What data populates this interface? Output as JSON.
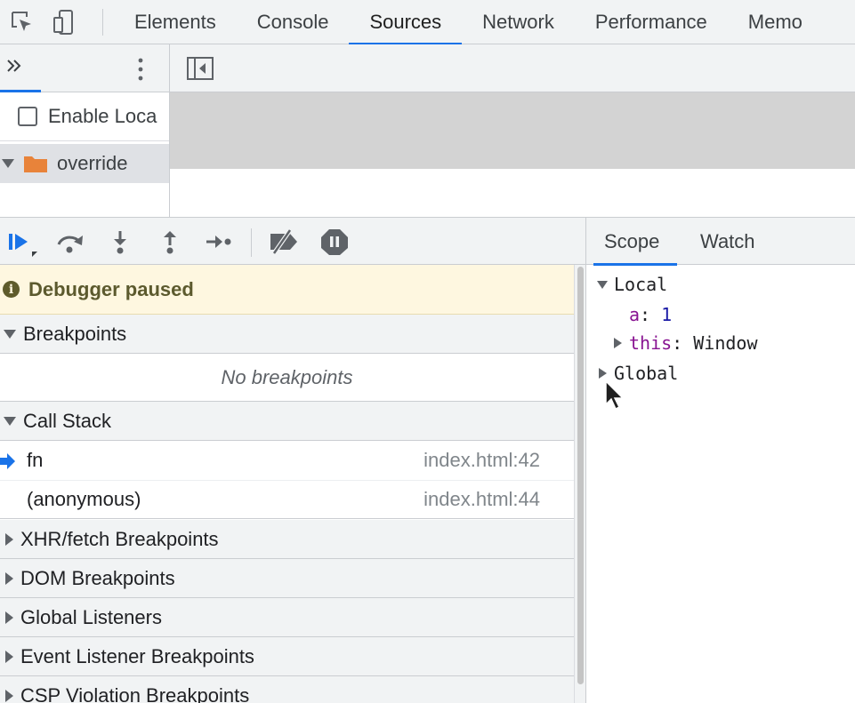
{
  "top_tabs": [
    "Elements",
    "Console",
    "Sources",
    "Network",
    "Performance",
    "Memo"
  ],
  "active_tab": "Sources",
  "navigator": {
    "enable_label": "Enable Loca",
    "folder_label": "override"
  },
  "debug_toolbar": {
    "icons": [
      "resume-icon",
      "step-over-icon",
      "step-into-icon",
      "step-out-icon",
      "step-icon",
      "deactivate-breakpoints-icon",
      "pause-on-exceptions-icon"
    ]
  },
  "sidebar": {
    "paused_label": "Debugger paused",
    "breakpoints_label": "Breakpoints",
    "no_breakpoints": "No breakpoints",
    "call_stack_label": "Call Stack",
    "frames": [
      {
        "name": "fn",
        "location": "index.html:42"
      },
      {
        "name": "(anonymous)",
        "location": "index.html:44"
      }
    ],
    "xhr_label": "XHR/fetch Breakpoints",
    "dom_label": "DOM Breakpoints",
    "global_label": "Global Listeners",
    "event_label": "Event Listener Breakpoints",
    "csp_label": "CSP Violation Breakpoints"
  },
  "scope": {
    "tab_scope": "Scope",
    "tab_watch": "Watch",
    "local_label": "Local",
    "var_a_key": "a",
    "var_a_value": "1",
    "this_key": "this",
    "this_value": "Window",
    "global_label": "Global"
  },
  "colors": {
    "accent": "#1a73e8",
    "paused_bg": "#fef7e0",
    "folder": "#e8833a"
  }
}
